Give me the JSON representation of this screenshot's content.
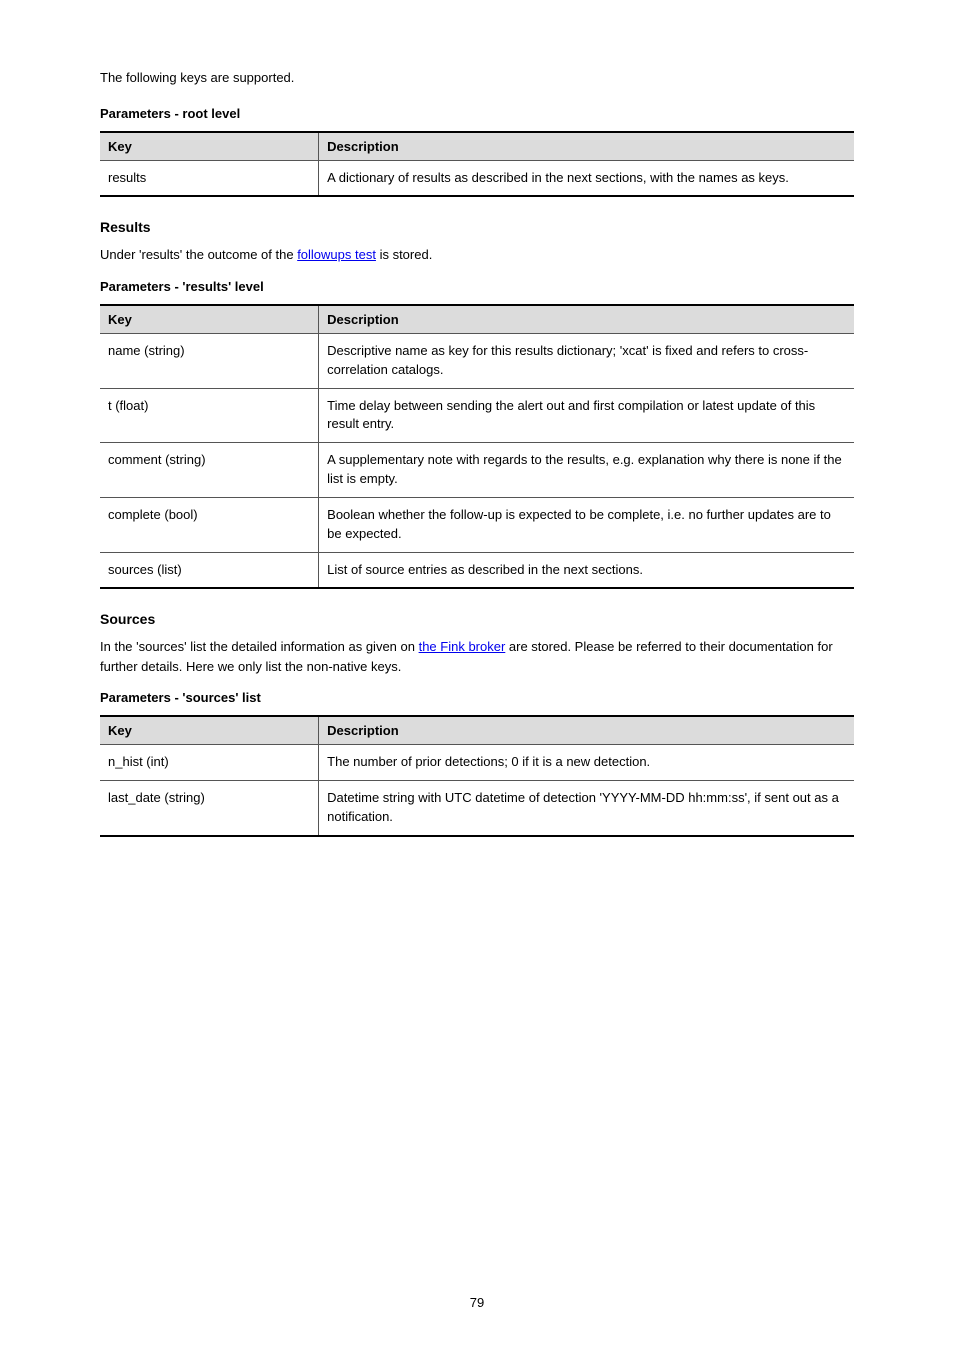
{
  "intro": "The following keys are supported.",
  "table1": {
    "sub": "Parameters - root level",
    "head": {
      "c1": "Key",
      "c2": "Description"
    },
    "rows": [
      {
        "c1": "results",
        "c2": "A dictionary of results as described in the next sections, with the names as keys."
      }
    ]
  },
  "section_results": {
    "heading": "Results",
    "intro_pre": "Under 'results' the outcome of the ",
    "intro_link": "followups test",
    "intro_post": " is stored.",
    "sub": "Parameters - 'results' level",
    "head": {
      "c1": "Key",
      "c2": "Description"
    },
    "rows": [
      {
        "c1": "name (string)",
        "c2": "Descriptive name as key for this results dictionary; 'xcat' is fixed and refers to cross-correlation catalogs."
      },
      {
        "c1": "t (float)",
        "c2": "Time delay between sending the alert out and first compilation or latest update of this result entry."
      },
      {
        "c1": "comment (string)",
        "c2": "A supplementary note with regards to the results, e.g. explanation why there is none if the list is empty."
      },
      {
        "c1": "complete (bool)",
        "c2": "Boolean whether the follow-up is expected to be complete, i.e. no further updates are to be expected."
      },
      {
        "c1": "sources (list)",
        "c2": "List of source entries as described in the next sections."
      }
    ]
  },
  "section_sources": {
    "heading": "Sources",
    "para_pre": "In the 'sources' list the detailed information as given on ",
    "para_link": "the Fink broker",
    "para_post": " are stored. Please be referred to their documentation for further details. Here we only list the non-native keys.",
    "sub": "Parameters - 'sources' list",
    "head": {
      "c1": "Key",
      "c2": "Description"
    },
    "rows": [
      {
        "c1": "n_hist (int)",
        "c2": "The number of prior detections; 0 if it is a new detection."
      },
      {
        "c1": "last_date (string)",
        "c2": "Datetime string with UTC datetime of detection 'YYYY-MM-DD hh:mm:ss', if sent out as a notification."
      }
    ]
  },
  "page_number": "79"
}
